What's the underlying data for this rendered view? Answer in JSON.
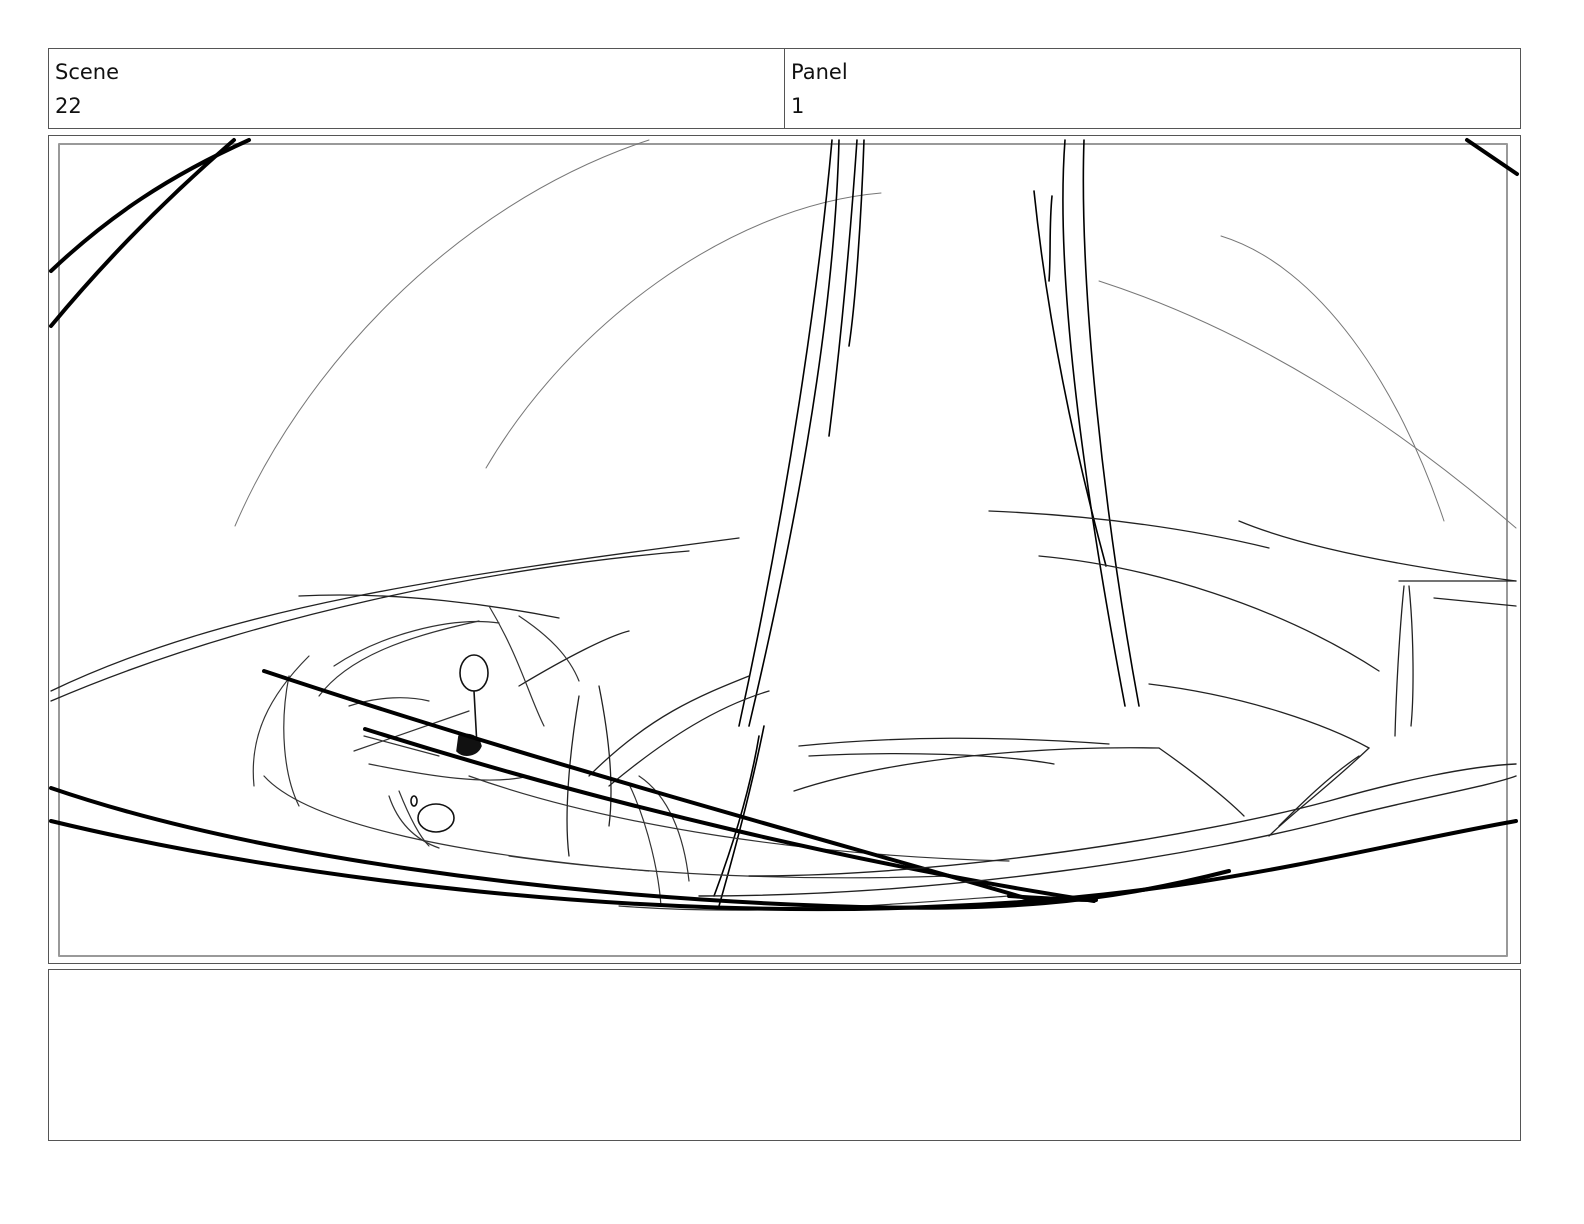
{
  "header": {
    "scene_label": "Scene",
    "scene_value": "22",
    "panel_label": "Panel",
    "panel_value": "1"
  },
  "notes": {
    "text": ""
  }
}
